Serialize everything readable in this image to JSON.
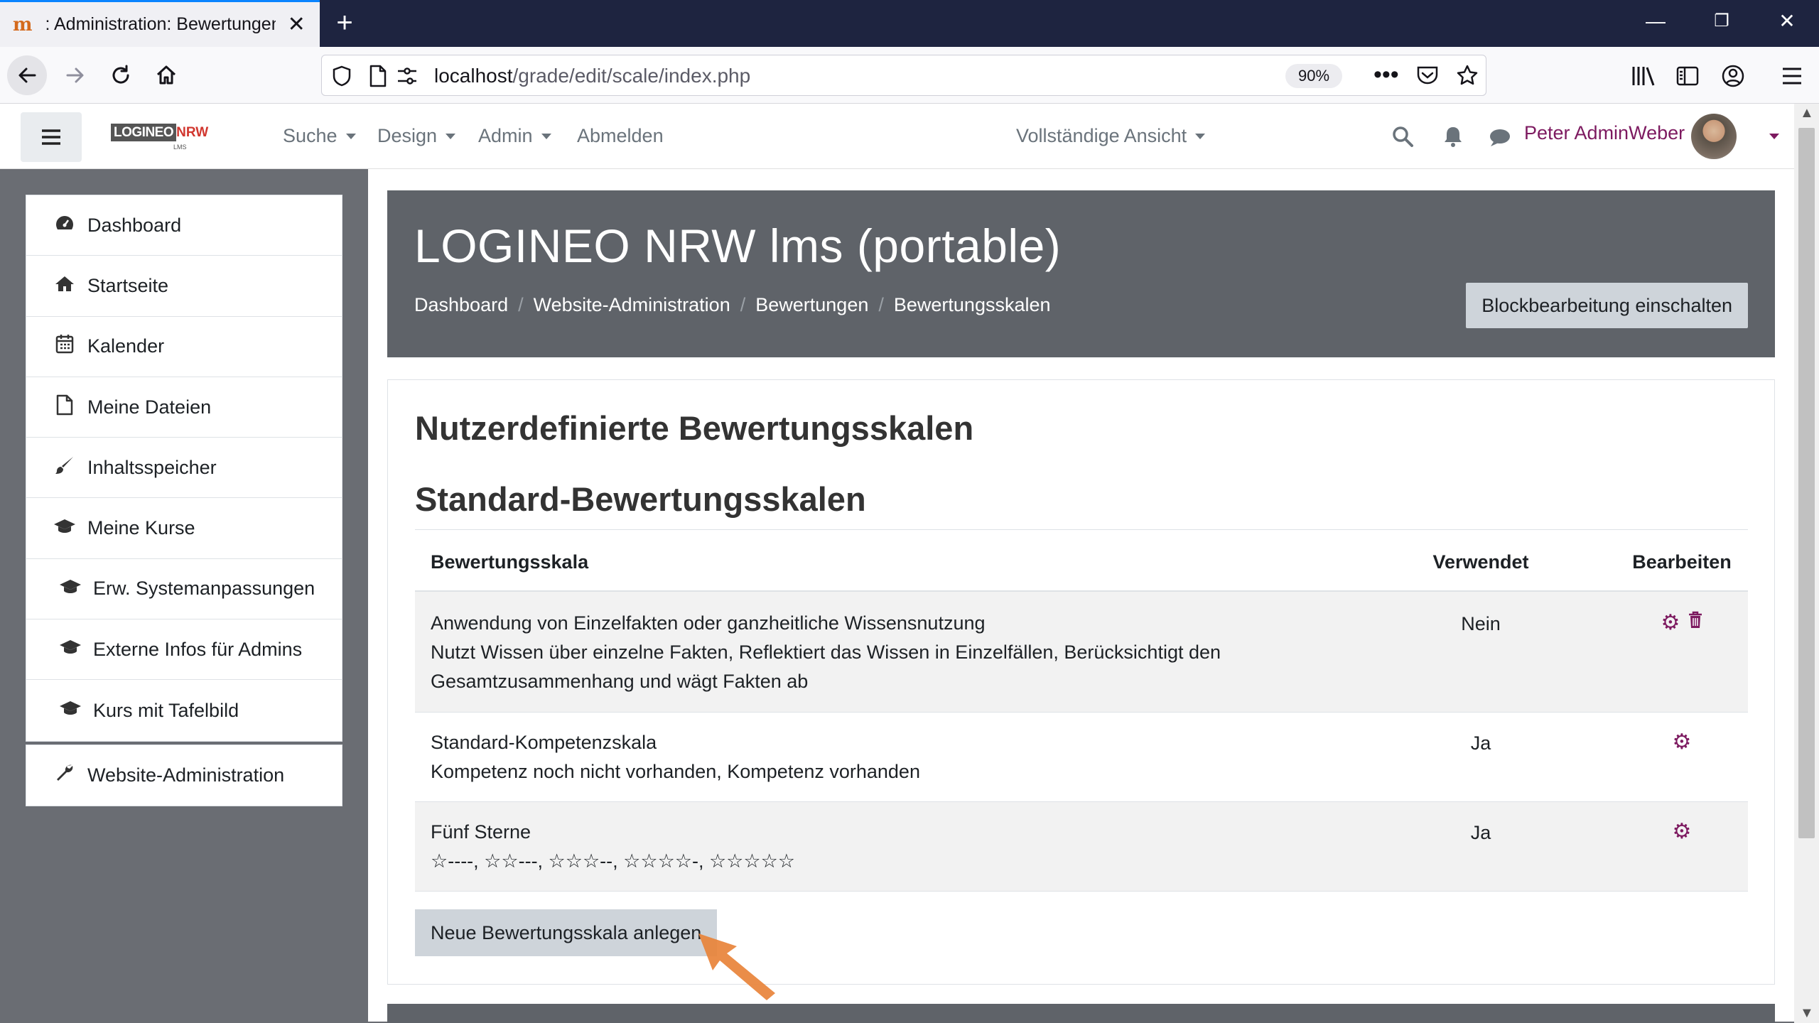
{
  "browser": {
    "tab_title": ": Administration: Bewertungen: Bewertungsskalen",
    "tab_close": "✕",
    "new_tab": "+",
    "url_host": "localhost",
    "url_path": "/grade/edit/scale/index.php",
    "zoom": "90%",
    "window_controls": {
      "minimize": "—",
      "restore": "❐",
      "close": "✕"
    }
  },
  "header": {
    "logo_main": "LOGINEO",
    "logo_accent": "NRW",
    "logo_sub": "LMS",
    "nav": [
      {
        "label": "Suche",
        "dropdown": true
      },
      {
        "label": "Design",
        "dropdown": true
      },
      {
        "label": "Admin",
        "dropdown": true
      },
      {
        "label": "Abmelden",
        "dropdown": false
      }
    ],
    "view_mode": "Vollständige Ansicht",
    "user_name": "Peter AdminWeber"
  },
  "sidebar": {
    "items": [
      {
        "label": "Dashboard",
        "icon": "dashboard-icon"
      },
      {
        "label": "Startseite",
        "icon": "home-icon"
      },
      {
        "label": "Kalender",
        "icon": "calendar-icon"
      },
      {
        "label": "Meine Dateien",
        "icon": "file-icon"
      },
      {
        "label": "Inhaltsspeicher",
        "icon": "brush-icon"
      },
      {
        "label": "Meine Kurse",
        "icon": "graduation-cap-icon"
      },
      {
        "label": "Erw. Systemanpassungen",
        "icon": "graduation-cap-icon"
      },
      {
        "label": "Externe Infos für Admins",
        "icon": "graduation-cap-icon"
      },
      {
        "label": "Kurs mit Tafelbild",
        "icon": "graduation-cap-icon"
      }
    ],
    "admin_item": {
      "label": "Website-Administration",
      "icon": "wrench-icon"
    }
  },
  "page": {
    "title": "LOGINEO NRW lms (portable)",
    "breadcrumb": [
      "Dashboard",
      "Website-Administration",
      "Bewertungen",
      "Bewertungsskalen"
    ],
    "block_edit_button": "Blockbearbeitung einschalten",
    "heading_custom": "Nutzerdefinierte Bewertungsskalen",
    "heading_standard": "Standard-Bewertungsskalen",
    "table": {
      "headers": {
        "scale": "Bewertungsskala",
        "used": "Verwendet",
        "edit": "Bearbeiten"
      },
      "rows": [
        {
          "name": "Anwendung von Einzelfakten oder ganzheitliche Wissensnutzung",
          "desc1": "Nutzt Wissen über einzelne Fakten, Reflektiert das Wissen in Einzelfällen, Berücksichtigt den",
          "desc2": "Gesamtzusammenhang und wägt Fakten ab",
          "used": "Nein",
          "actions": [
            "gear-icon",
            "trash-icon"
          ]
        },
        {
          "name": "Standard-Kompetenzskala",
          "desc1": "Kompetenz noch nicht vorhanden, Kompetenz vorhanden",
          "used": "Ja",
          "actions": [
            "gear-icon"
          ]
        },
        {
          "name": "Fünf Sterne",
          "desc1": "☆----, ☆☆---, ☆☆☆--, ☆☆☆☆-, ☆☆☆☆☆",
          "used": "Ja",
          "actions": [
            "gear-icon"
          ]
        }
      ]
    },
    "new_scale_button": "Neue Bewertungsskala anlegen"
  },
  "colors": {
    "accent": "#7d1a60",
    "page_header_bg": "#5f6369",
    "sidebar_bg": "#6a6d73",
    "tabbar_bg": "#1e2440",
    "arrow": "#e8833a"
  }
}
